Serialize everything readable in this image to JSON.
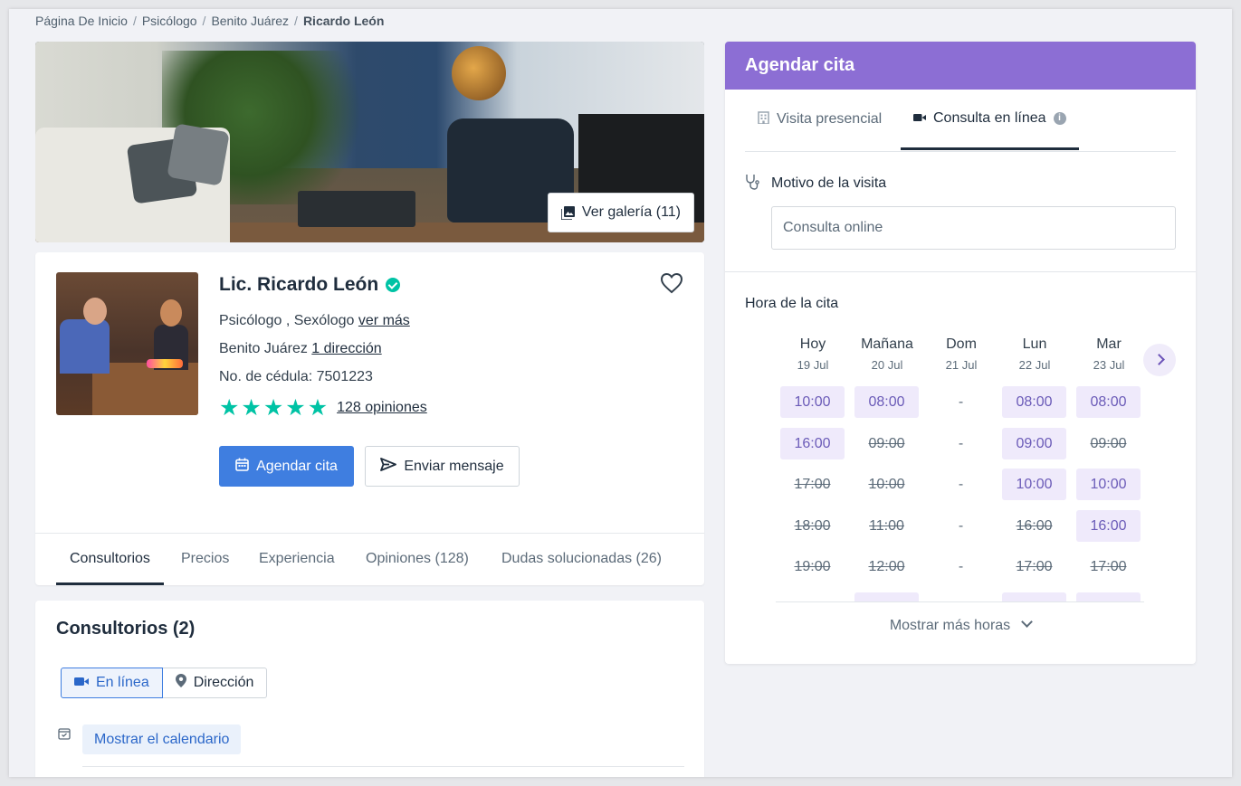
{
  "breadcrumb": [
    "Página De Inicio",
    "Psicólogo",
    "Benito Juárez",
    "Ricardo León"
  ],
  "hero": {
    "gallery_label": "Ver galería (11)"
  },
  "profile": {
    "name": "Lic. Ricardo León",
    "specialties": "Psicólogo , Sexólogo",
    "specialties_more": "ver más",
    "location": "Benito Juárez",
    "location_link": "1 dirección",
    "license": "No. de cédula: 7501223",
    "rating_stars": 5,
    "reviews_link": "128 opiniones",
    "book_button": "Agendar cita",
    "message_button": "Enviar mensaje"
  },
  "profile_tabs": [
    "Consultorios",
    "Precios",
    "Experiencia",
    "Opiniones (128)",
    "Dudas solucionadas (26)"
  ],
  "consultorios": {
    "title": "Consultorios (2)",
    "seg_online": "En línea",
    "seg_address": "Dirección",
    "show_calendar": "Mostrar el calendario"
  },
  "booking": {
    "title": "Agendar cita",
    "tab_inperson": "Visita presencial",
    "tab_online": "Consulta en línea",
    "motivo_label": "Motivo de la visita",
    "motivo_value": "Consulta online",
    "hora_label": "Hora de la cita",
    "days": [
      {
        "name": "Hoy",
        "date": "19 Jul"
      },
      {
        "name": "Mañana",
        "date": "20 Jul"
      },
      {
        "name": "Dom",
        "date": "21 Jul"
      },
      {
        "name": "Lun",
        "date": "22 Jul"
      },
      {
        "name": "Mar",
        "date": "23 Jul"
      }
    ],
    "slots": [
      [
        {
          "t": "10:00",
          "s": "avail"
        },
        {
          "t": "16:00",
          "s": "avail"
        },
        {
          "t": "17:00",
          "s": "taken"
        },
        {
          "t": "18:00",
          "s": "taken"
        },
        {
          "t": "19:00",
          "s": "taken"
        }
      ],
      [
        {
          "t": "08:00",
          "s": "avail"
        },
        {
          "t": "09:00",
          "s": "taken"
        },
        {
          "t": "10:00",
          "s": "taken"
        },
        {
          "t": "11:00",
          "s": "taken"
        },
        {
          "t": "12:00",
          "s": "taken"
        },
        {
          "t": "",
          "s": "avail"
        }
      ],
      [
        {
          "t": "-",
          "s": "none"
        },
        {
          "t": "-",
          "s": "none"
        },
        {
          "t": "-",
          "s": "none"
        },
        {
          "t": "-",
          "s": "none"
        },
        {
          "t": "-",
          "s": "none"
        }
      ],
      [
        {
          "t": "08:00",
          "s": "avail"
        },
        {
          "t": "09:00",
          "s": "avail"
        },
        {
          "t": "10:00",
          "s": "avail"
        },
        {
          "t": "16:00",
          "s": "taken"
        },
        {
          "t": "17:00",
          "s": "taken"
        },
        {
          "t": "",
          "s": "avail"
        }
      ],
      [
        {
          "t": "08:00",
          "s": "avail"
        },
        {
          "t": "09:00",
          "s": "taken"
        },
        {
          "t": "10:00",
          "s": "avail"
        },
        {
          "t": "16:00",
          "s": "avail"
        },
        {
          "t": "17:00",
          "s": "taken"
        },
        {
          "t": "",
          "s": "avail"
        }
      ]
    ],
    "more_hours": "Mostrar más horas"
  },
  "colors": {
    "accent": "#8c6ed4",
    "primary": "#3f7ee0",
    "rating": "#00c3a5"
  }
}
